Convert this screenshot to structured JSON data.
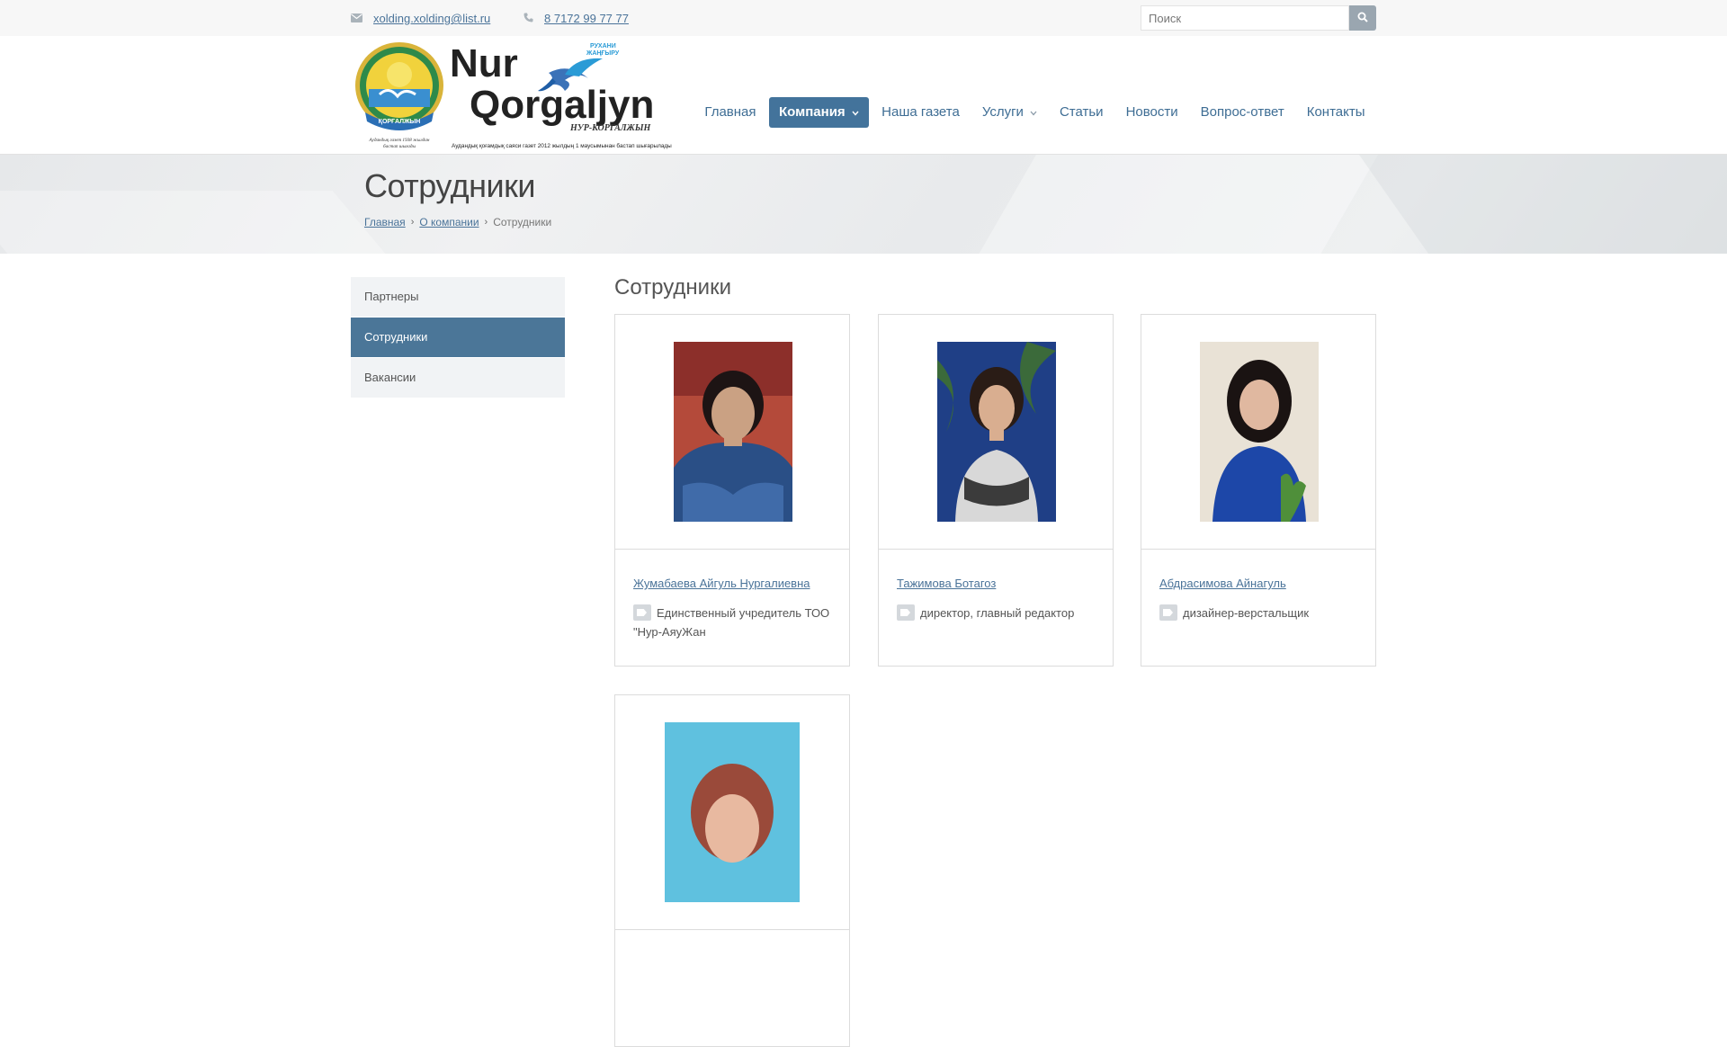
{
  "topbar": {
    "email": "xolding.xolding@list.ru",
    "phone": "8 7172 99 77 77",
    "search_placeholder": "Поиск"
  },
  "logo": {
    "title_line1": "Nur",
    "title_line2": "Qorgaljyn",
    "subtitle": "НУР-КОРГАЛЖЫН",
    "bird_caption_1": "РУХАНИ",
    "bird_caption_2": "ЖАҢҒЫРУ",
    "emblem_ribbon": "ҚОРҒАЛЖЫН",
    "emblem_caption_1": "Аудандық газет 1938 жылдан",
    "emblem_caption_2": "бастап шығады",
    "footer_text": "Аудандық қоғамдық саяси газет 2012 жылдың 1 маусымынан бастап шығарылады"
  },
  "nav": {
    "items": [
      {
        "label": "Главная"
      },
      {
        "label": "Компания",
        "active": true,
        "dropdown": true
      },
      {
        "label": "Наша газета"
      },
      {
        "label": "Услуги",
        "dropdown": true
      },
      {
        "label": "Статьи"
      },
      {
        "label": "Новости"
      },
      {
        "label": "Вопрос-ответ"
      },
      {
        "label": "Контакты"
      }
    ]
  },
  "page": {
    "title": "Сотрудники",
    "breadcrumb": [
      "Главная",
      "О компании",
      "Сотрудники"
    ]
  },
  "sidebar": {
    "items": [
      {
        "label": "Партнеры"
      },
      {
        "label": "Сотрудники",
        "active": true
      },
      {
        "label": "Вакансии"
      }
    ]
  },
  "main": {
    "section_title": "Сотрудники",
    "employees": [
      {
        "name": "Жумабаева Айгуль Нургалиевна",
        "role": "Единственный учредитель ТОО \"Нур-АяуЖан"
      },
      {
        "name": "Тажимова Ботагоз",
        "role": "директор, главный редактор"
      },
      {
        "name": "Абдрасимова Айнагуль",
        "role": "дизайнер-верстальщик"
      },
      {
        "name": "",
        "role": ""
      }
    ]
  },
  "colors": {
    "accent": "#43739b",
    "link": "#4a7399",
    "topbar_bg": "#f7f7f7",
    "sidebar_bg": "#f1f3f5"
  }
}
